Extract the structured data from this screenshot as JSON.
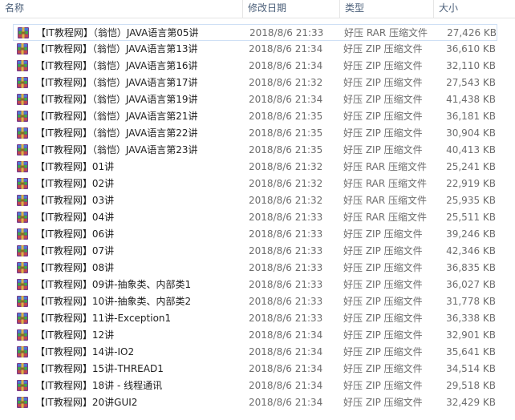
{
  "columns": {
    "name": "名称",
    "modified": "修改日期",
    "type": "类型",
    "size": "大小"
  },
  "files": [
    {
      "name": "【IT教程网】（翁恺）JAVA语言第05讲",
      "modified": "2018/8/6 21:33",
      "type": "好压 RAR 压缩文件",
      "size": "27,426 KB",
      "icon": "winrar-archive-icon",
      "selected": true
    },
    {
      "name": "【IT教程网】（翁恺）JAVA语言第13讲",
      "modified": "2018/8/6 21:34",
      "type": "好压 ZIP 压缩文件",
      "size": "36,610 KB",
      "icon": "winrar-archive-icon"
    },
    {
      "name": "【IT教程网】（翁恺）JAVA语言第16讲",
      "modified": "2018/8/6 21:34",
      "type": "好压 ZIP 压缩文件",
      "size": "32,110 KB",
      "icon": "winrar-archive-icon"
    },
    {
      "name": "【IT教程网】（翁恺）JAVA语言第17讲",
      "modified": "2018/8/6 21:32",
      "type": "好压 ZIP 压缩文件",
      "size": "27,543 KB",
      "icon": "winrar-archive-icon"
    },
    {
      "name": "【IT教程网】（翁恺）JAVA语言第19讲",
      "modified": "2018/8/6 21:34",
      "type": "好压 ZIP 压缩文件",
      "size": "41,438 KB",
      "icon": "winrar-archive-icon"
    },
    {
      "name": "【IT教程网】（翁恺）JAVA语言第21讲",
      "modified": "2018/8/6 21:35",
      "type": "好压 ZIP 压缩文件",
      "size": "36,181 KB",
      "icon": "winrar-archive-icon"
    },
    {
      "name": "【IT教程网】（翁恺）JAVA语言第22讲",
      "modified": "2018/8/6 21:35",
      "type": "好压 ZIP 压缩文件",
      "size": "30,904 KB",
      "icon": "winrar-archive-icon"
    },
    {
      "name": "【IT教程网】（翁恺）JAVA语言第23讲",
      "modified": "2018/8/6 21:35",
      "type": "好压 ZIP 压缩文件",
      "size": "40,413 KB",
      "icon": "winrar-archive-icon"
    },
    {
      "name": "【IT教程网】01讲",
      "modified": "2018/8/6 21:32",
      "type": "好压 RAR 压缩文件",
      "size": "25,241 KB",
      "icon": "winrar-archive-icon"
    },
    {
      "name": "【IT教程网】02讲",
      "modified": "2018/8/6 21:32",
      "type": "好压 RAR 压缩文件",
      "size": "22,919 KB",
      "icon": "winrar-archive-icon"
    },
    {
      "name": "【IT教程网】03讲",
      "modified": "2018/8/6 21:32",
      "type": "好压 RAR 压缩文件",
      "size": "25,935 KB",
      "icon": "winrar-archive-icon"
    },
    {
      "name": "【IT教程网】04讲",
      "modified": "2018/8/6 21:33",
      "type": "好压 RAR 压缩文件",
      "size": "25,511 KB",
      "icon": "winrar-archive-icon"
    },
    {
      "name": "【IT教程网】06讲",
      "modified": "2018/8/6 21:33",
      "type": "好压 ZIP 压缩文件",
      "size": "39,246 KB",
      "icon": "winrar-archive-icon"
    },
    {
      "name": "【IT教程网】07讲",
      "modified": "2018/8/6 21:33",
      "type": "好压 ZIP 压缩文件",
      "size": "42,346 KB",
      "icon": "winrar-archive-icon"
    },
    {
      "name": "【IT教程网】08讲",
      "modified": "2018/8/6 21:33",
      "type": "好压 ZIP 压缩文件",
      "size": "36,835 KB",
      "icon": "winrar-archive-icon"
    },
    {
      "name": "【IT教程网】09讲-抽象类、内部类1",
      "modified": "2018/8/6 21:33",
      "type": "好压 ZIP 压缩文件",
      "size": "36,027 KB",
      "icon": "winrar-archive-icon"
    },
    {
      "name": "【IT教程网】10讲-抽象类、内部类2",
      "modified": "2018/8/6 21:33",
      "type": "好压 ZIP 压缩文件",
      "size": "31,778 KB",
      "icon": "winrar-archive-icon"
    },
    {
      "name": "【IT教程网】11讲-Exception1",
      "modified": "2018/8/6 21:33",
      "type": "好压 ZIP 压缩文件",
      "size": "36,338 KB",
      "icon": "winrar-archive-icon"
    },
    {
      "name": "【IT教程网】12讲",
      "modified": "2018/8/6 21:34",
      "type": "好压 ZIP 压缩文件",
      "size": "32,901 KB",
      "icon": "winrar-archive-icon"
    },
    {
      "name": "【IT教程网】14讲-IO2",
      "modified": "2018/8/6 21:34",
      "type": "好压 ZIP 压缩文件",
      "size": "35,641 KB",
      "icon": "winrar-archive-icon"
    },
    {
      "name": "【IT教程网】15讲-THREAD1",
      "modified": "2018/8/6 21:34",
      "type": "好压 ZIP 压缩文件",
      "size": "34,514 KB",
      "icon": "winrar-archive-icon"
    },
    {
      "name": "【IT教程网】18讲 - 线程通讯",
      "modified": "2018/8/6 21:34",
      "type": "好压 ZIP 压缩文件",
      "size": "29,518 KB",
      "icon": "winrar-archive-icon"
    },
    {
      "name": "【IT教程网】20讲GUI2",
      "modified": "2018/8/6 21:34",
      "type": "好压 ZIP 压缩文件",
      "size": "32,429 KB",
      "icon": "winrar-archive-icon"
    }
  ],
  "colors": {
    "header_text": "#4c607a",
    "selection_border": "#cfe0f5",
    "secondary_text": "#6d6d6d"
  }
}
